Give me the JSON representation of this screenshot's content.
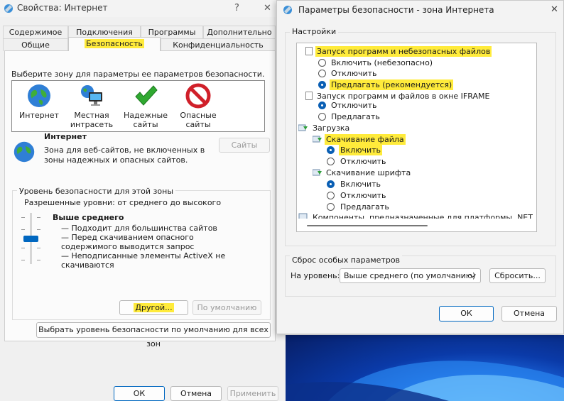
{
  "left_window": {
    "title": "Свойства: Интернет",
    "help_glyph": "?",
    "close_glyph": "✕",
    "tabs_row1": [
      "Содержимое",
      "Подключения",
      "Программы",
      "Дополнительно"
    ],
    "tabs_row2": [
      "Общие",
      "Безопасность",
      "Конфиденциальность"
    ],
    "zone_prompt": "Выберите зону для параметры ее параметров безопасности.",
    "zones": [
      {
        "label": "Интернет",
        "icon": "globe-icon"
      },
      {
        "label": "Местная интрасеть",
        "icon": "intranet-icon"
      },
      {
        "label": "Надежные сайты",
        "icon": "checkmark-icon"
      },
      {
        "label": "Опасные сайты",
        "icon": "no-entry-icon"
      }
    ],
    "zone_name": "Интернет",
    "zone_description": "Зона для веб-сайтов, не включенных в зоны надежных и опасных сайтов.",
    "sites_button": "Сайты",
    "level_group_title": "Уровень безопасности для этой зоны",
    "allowed_levels": "Разрешенные уровни: от среднего до высокого",
    "level_name": "Выше среднего",
    "level_bullets": [
      "— Подходит для большинства сайтов",
      "— Перед скачиванием опасного содержимого выводится запрос",
      "— Неподписанные элементы ActiveX не скачиваются"
    ],
    "custom_button": "Другой...",
    "default_button": "По умолчанию",
    "reset_all_button": "Выбрать уровень безопасности по умолчанию для всех зон",
    "ok": "ОК",
    "cancel": "Отмена",
    "apply": "Применить"
  },
  "right_window": {
    "title": "Параметры безопасности - зона Интернета",
    "close_glyph": "✕",
    "settings_label": "Настройки",
    "tree": [
      {
        "type": "item",
        "label": "Запуск программ и небезопасных файлов",
        "highlight": true
      },
      {
        "type": "radio",
        "label": "Включить (небезопасно)",
        "checked": false
      },
      {
        "type": "radio",
        "label": "Отключить",
        "checked": false
      },
      {
        "type": "radio",
        "label": "Предлагать (рекомендуется)",
        "checked": true,
        "highlight": true
      },
      {
        "type": "item",
        "label": "Запуск программ и файлов в окне IFRAME"
      },
      {
        "type": "radio",
        "label": "Отключить",
        "checked": true
      },
      {
        "type": "radio",
        "label": "Предлагать",
        "checked": false
      },
      {
        "type": "group",
        "label": "Загрузка"
      },
      {
        "type": "subitem",
        "label": "Скачивание файла",
        "highlight": true
      },
      {
        "type": "radio",
        "label": "Включить",
        "checked": true,
        "highlight": true
      },
      {
        "type": "radio",
        "label": "Отключить",
        "checked": false
      },
      {
        "type": "subitem",
        "label": "Скачивание шрифта"
      },
      {
        "type": "radio",
        "label": "Включить",
        "checked": true
      },
      {
        "type": "radio",
        "label": "Отключить",
        "checked": false
      },
      {
        "type": "radio",
        "label": "Предлагать",
        "checked": false
      },
      {
        "type": "group",
        "label": "Компоненты, предназначенные для платформы .NET Framew"
      }
    ],
    "reset_group_title": "Сброс особых параметров",
    "reset_to_label": "На уровень:",
    "reset_level_value": "Выше среднего (по умолчанию)",
    "reset_button": "Сбросить...",
    "ok": "ОК",
    "cancel": "Отмена"
  },
  "colors": {
    "highlight": "#ffeb3b",
    "accent": "#0067c0"
  }
}
